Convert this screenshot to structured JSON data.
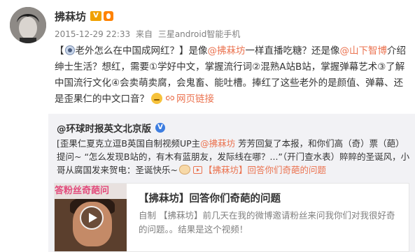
{
  "post": {
    "author": "拂菻坊",
    "vip_badge_text": "V",
    "timestamp": "2015-12-29 22:33",
    "source_prefix": "来自",
    "source_device": "三星android智能手机",
    "text": {
      "open_bracket": "【",
      "q1": "老外怎么在中国成网红？",
      "close_bracket": "】",
      "p1": "是像",
      "mention1": "@拂菻坊",
      "p2": "一样直播吃糖？还是像",
      "mention2": "@山下智博",
      "p3": "介绍绅士生活？想红，需要①学好中文，掌握流行词②混熟A站B站，掌握弹幕艺术③了解中国流行文化④会卖萌卖腐，会鬼畜、能吐槽。捧红了这些老外的是颜值、弹幕、还是歪果仁的中文口音？",
      "web_link": "网页链接"
    },
    "colors": {
      "link": "#eb7350",
      "repost_bg": "#f2f2f5",
      "meta": "#808080"
    }
  },
  "repost": {
    "author": "@环球时报英文北京版",
    "verified_badge": "V",
    "text": {
      "p1": "[歪果仁夏克立逗B英国自制视频UP主",
      "mention": "@拂菻坊",
      "p2": " 芳芳回复了本报，和你们高（奇）票（葩）提问~ “怎么发现B站的，有木有蓝朋友，发际线在哪？...”（开门查水表）賥賥的圣诞风，小哥从腐国发来贺电：圣诞快乐~",
      "video_link": "【拂菻坊】回答你们奇葩的问题"
    },
    "card": {
      "thumb_title": "答粉丝奇葩问",
      "title": "【拂菻坊】回答你们奇葩的问题",
      "description": "自制 【拂菻坊】前几天在我的微博邀请粉丝来问我你们对我很好奇的问题。。结果是这个视频！"
    }
  }
}
